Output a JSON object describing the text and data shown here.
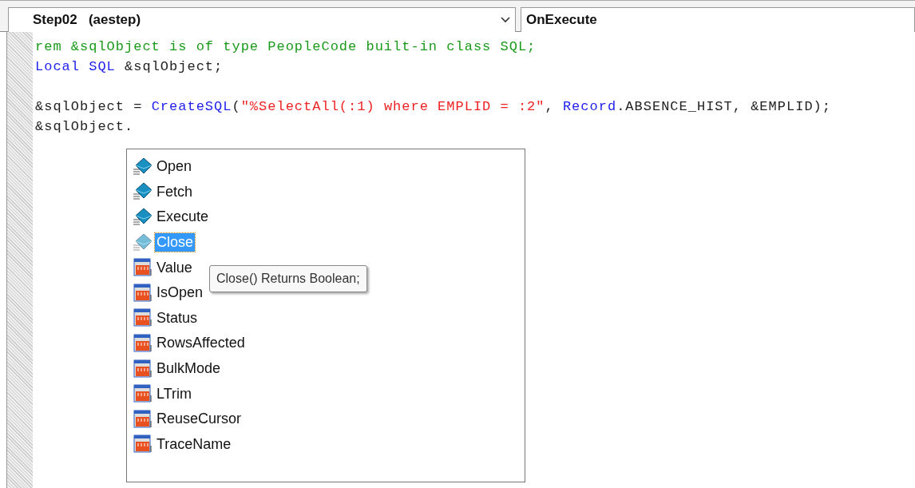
{
  "toolbar": {
    "object": "Step02   (aestep)",
    "event": "OnExecute"
  },
  "code_lines": [
    [
      {
        "text": "rem &sqlObject is of type PeopleCode built-in class SQL;",
        "kind": "comment"
      }
    ],
    [
      {
        "text": "Local SQL",
        "kind": "keyword"
      },
      {
        "text": " &sqlObject;",
        "kind": "plain"
      }
    ],
    [
      {
        "text": "&sqlObject = ",
        "kind": "plain"
      },
      {
        "text": "CreateSQL",
        "kind": "keyword"
      },
      {
        "text": "(",
        "kind": "plain"
      },
      {
        "text": "\"%SelectAll(:1) where EMPLID = :2\"",
        "kind": "string"
      },
      {
        "text": ", ",
        "kind": "plain"
      },
      {
        "text": "Record",
        "kind": "keyword"
      },
      {
        "text": ".ABSENCE_HIST, &EMPLID);",
        "kind": "plain"
      }
    ],
    [
      {
        "text": "&sqlObject.",
        "kind": "plain"
      }
    ]
  ],
  "completion": {
    "items": [
      {
        "label": "Open",
        "kind": "method",
        "selected": false
      },
      {
        "label": "Fetch",
        "kind": "method",
        "selected": false
      },
      {
        "label": "Execute",
        "kind": "method",
        "selected": false
      },
      {
        "label": "Close",
        "kind": "method",
        "selected": true
      },
      {
        "label": "Value",
        "kind": "property",
        "selected": false
      },
      {
        "label": "IsOpen",
        "kind": "property",
        "selected": false
      },
      {
        "label": "Status",
        "kind": "property",
        "selected": false
      },
      {
        "label": "RowsAffected",
        "kind": "property",
        "selected": false
      },
      {
        "label": "BulkMode",
        "kind": "property",
        "selected": false
      },
      {
        "label": "LTrim",
        "kind": "property",
        "selected": false
      },
      {
        "label": "ReuseCursor",
        "kind": "property",
        "selected": false
      },
      {
        "label": "TraceName",
        "kind": "property",
        "selected": false
      }
    ],
    "tooltip": "Close() Returns Boolean;"
  }
}
